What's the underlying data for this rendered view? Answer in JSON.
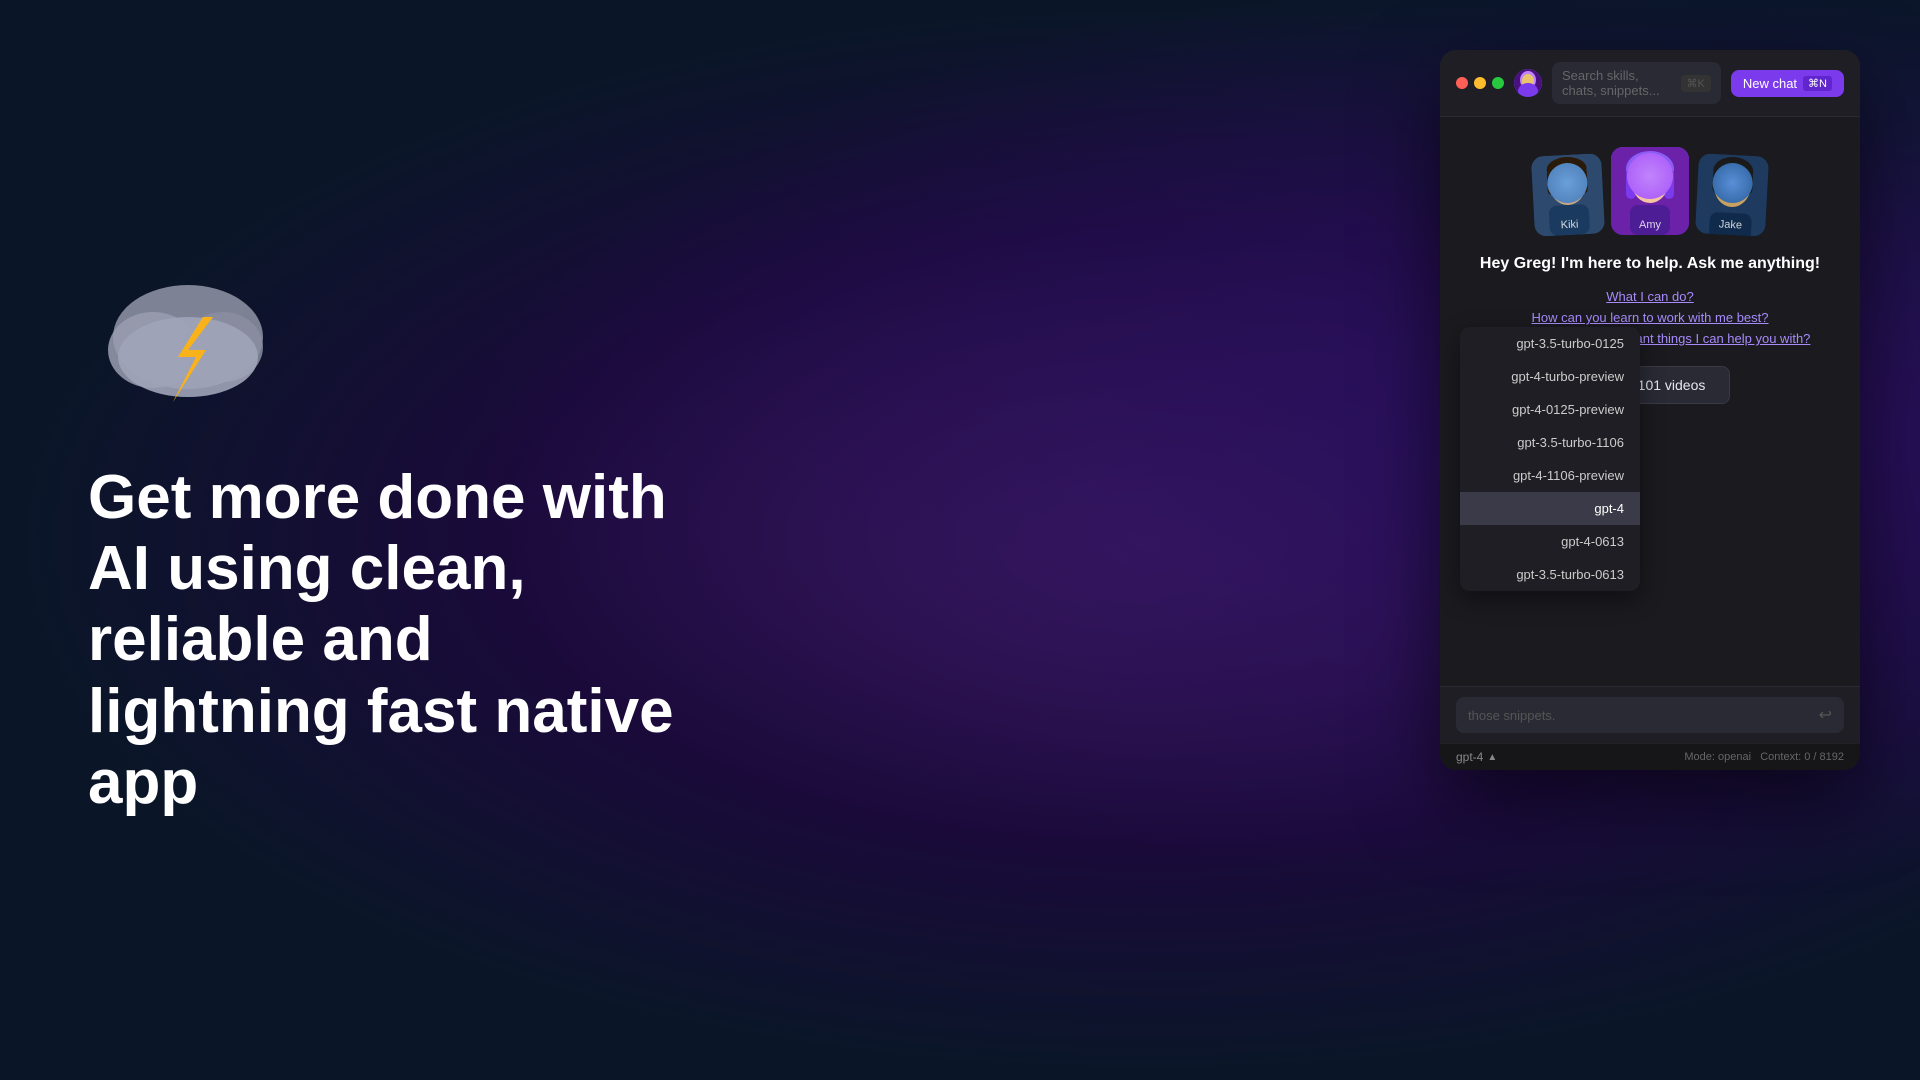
{
  "background": {
    "color1": "#0a1628",
    "color2": "#3d1a5e"
  },
  "hero": {
    "headline": "Get more done with AI using clean, reliable and lightning fast native app"
  },
  "agents": [
    {
      "name": "Kiki",
      "label": "Kiki"
    },
    {
      "name": "Amy",
      "label": "Amy"
    },
    {
      "name": "Jake",
      "label": "Jake"
    }
  ],
  "chat": {
    "welcome_message": "Hey Greg! I'm here to help. Ask me anything!",
    "suggestions": [
      "What I can do?",
      "How can you learn to work with me best?",
      "What are the most important things I can help you with?"
    ],
    "watch_videos_label": "Watch 101 videos"
  },
  "search": {
    "placeholder": "Search skills, chats, snippets...",
    "shortcut": "⌘K"
  },
  "new_chat": {
    "label": "New chat",
    "shortcut": "⌘N"
  },
  "models": [
    {
      "id": "gpt-3.5-turbo-0125",
      "label": "gpt-3.5-turbo-0125",
      "active": false
    },
    {
      "id": "gpt-4-turbo-preview",
      "label": "gpt-4-turbo-preview",
      "active": false
    },
    {
      "id": "gpt-4-0125-preview",
      "label": "gpt-4-0125-preview",
      "active": false
    },
    {
      "id": "gpt-3.5-turbo-1106",
      "label": "gpt-3.5-turbo-1106",
      "active": false
    },
    {
      "id": "gpt-4-1106-preview",
      "label": "gpt-4-1106-preview",
      "active": false
    },
    {
      "id": "gpt-4",
      "label": "gpt-4",
      "active": true
    },
    {
      "id": "gpt-4-0613",
      "label": "gpt-4-0613",
      "active": false
    },
    {
      "id": "gpt-3.5-turbo-0613",
      "label": "gpt-3.5-turbo-0613",
      "active": false
    }
  ],
  "input": {
    "placeholder": "those snippets.",
    "ghost_text": ""
  },
  "status": {
    "model": "gpt-4",
    "mode": "Mode: openai",
    "context": "Context: 0 / 8192"
  }
}
